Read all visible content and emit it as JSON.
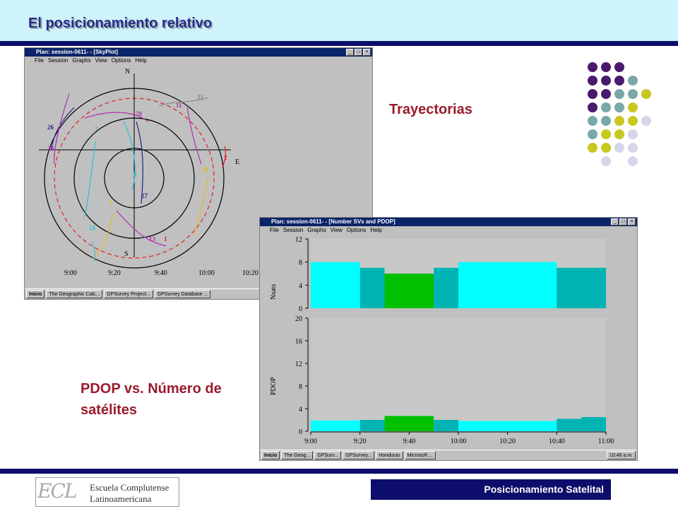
{
  "header": {
    "title": "El posicionamiento relativo"
  },
  "footer": {
    "badge": "Posicionamiento Satelital"
  },
  "logo": {
    "mark": "ECL",
    "line1": "Escuela Complutense",
    "line2": "Latinoamericana"
  },
  "labels": {
    "trayectorias": "Trayectorias",
    "pdop_line1": "PDOP vs. Número de",
    "pdop_line2": "satélites"
  },
  "colors": {
    "accent": "#0d0d6b",
    "label_red": "#9a1b2c",
    "header_bg": "#cff3fb",
    "bar_cyan": "#00ffff",
    "bar_teal": "#00b4b4",
    "bar_green": "#00c000"
  },
  "dots": {
    "rows": [
      [
        "purple",
        "purple",
        "purple"
      ],
      [
        "purple",
        "purple",
        "purple",
        "teal"
      ],
      [
        "purple",
        "purple",
        "teal",
        "teal",
        "yellow"
      ],
      [
        "purple",
        "teal",
        "teal",
        "yellow"
      ],
      [
        "teal",
        "teal",
        "yellow",
        "yellow",
        "lavender"
      ],
      [
        "teal",
        "yellow",
        "yellow",
        "lavender"
      ],
      [
        "yellow",
        "yellow",
        "lavender",
        "lavender"
      ],
      [
        "lavender",
        "lavender"
      ]
    ],
    "palette": {
      "purple": "#4a1a6e",
      "teal": "#7aa8a8",
      "yellow": "#c8c81e",
      "lavender": "#d6d6ea"
    }
  },
  "skyplot_window": {
    "title": "Plan: session-0611- - [SkyPlot]",
    "menu": [
      "File",
      "Session",
      "Graphs",
      "View",
      "Options",
      "Help"
    ],
    "compass": {
      "n": "N",
      "s": "S",
      "e": "E"
    },
    "satellites": [
      "31",
      "11",
      "28",
      "26",
      "7",
      "29",
      "2",
      "20",
      "8",
      "27",
      "4",
      "24",
      "13",
      "1"
    ],
    "time_ticks": [
      "9:00",
      "9:20",
      "9:40",
      "10:00",
      "10:20"
    ],
    "taskbar": [
      "Inicio",
      "The Geographic Calc...",
      "GPSurvey Project...",
      "GPSurvey Database ..."
    ]
  },
  "pdop_window": {
    "title": "Plan: session-0611- - [Number SVs and PDOP]",
    "menu": [
      "File",
      "Session",
      "Graphs",
      "View",
      "Options",
      "Help"
    ],
    "taskbar": [
      "Inicio",
      "The Geog...",
      "GPSurv...",
      "GPSurvey...",
      "Honduras",
      "Microsoft ..."
    ],
    "clock": "10:48 a.m."
  },
  "chart_data": [
    {
      "type": "bar",
      "ylabel": "Nsats",
      "ylim": [
        0,
        12
      ],
      "yticks": [
        "12",
        "8",
        "4",
        "0"
      ],
      "x": [
        "9:00",
        "9:20",
        "9:30",
        "9:50",
        "10:00",
        "10:40",
        "11:00"
      ],
      "segments": [
        {
          "from": "9:00",
          "to": "9:20",
          "value": 8,
          "color": "cyan"
        },
        {
          "from": "9:20",
          "to": "9:30",
          "value": 7,
          "color": "teal"
        },
        {
          "from": "9:30",
          "to": "9:50",
          "value": 6,
          "color": "green"
        },
        {
          "from": "9:50",
          "to": "10:00",
          "value": 7,
          "color": "teal"
        },
        {
          "from": "10:00",
          "to": "10:40",
          "value": 8,
          "color": "cyan"
        },
        {
          "from": "10:40",
          "to": "11:00",
          "value": 7,
          "color": "teal"
        }
      ]
    },
    {
      "type": "bar",
      "ylabel": "PDOP",
      "ylim": [
        0,
        20
      ],
      "yticks": [
        "20",
        "16",
        "12",
        "8",
        "4",
        "0"
      ],
      "xticks": [
        "9:00",
        "9:20",
        "9:40",
        "10:00",
        "10:20",
        "10:40",
        "11:00"
      ],
      "segments": [
        {
          "from": "9:00",
          "to": "9:20",
          "value": 1.9,
          "color": "cyan"
        },
        {
          "from": "9:20",
          "to": "9:30",
          "value": 2.0,
          "color": "teal"
        },
        {
          "from": "9:30",
          "to": "9:50",
          "value": 2.7,
          "color": "green"
        },
        {
          "from": "9:50",
          "to": "10:00",
          "value": 2.0,
          "color": "teal"
        },
        {
          "from": "10:00",
          "to": "10:40",
          "value": 1.8,
          "color": "cyan"
        },
        {
          "from": "10:40",
          "to": "10:50",
          "value": 2.2,
          "color": "teal"
        },
        {
          "from": "10:50",
          "to": "11:00",
          "value": 2.5,
          "color": "teal"
        }
      ]
    }
  ]
}
